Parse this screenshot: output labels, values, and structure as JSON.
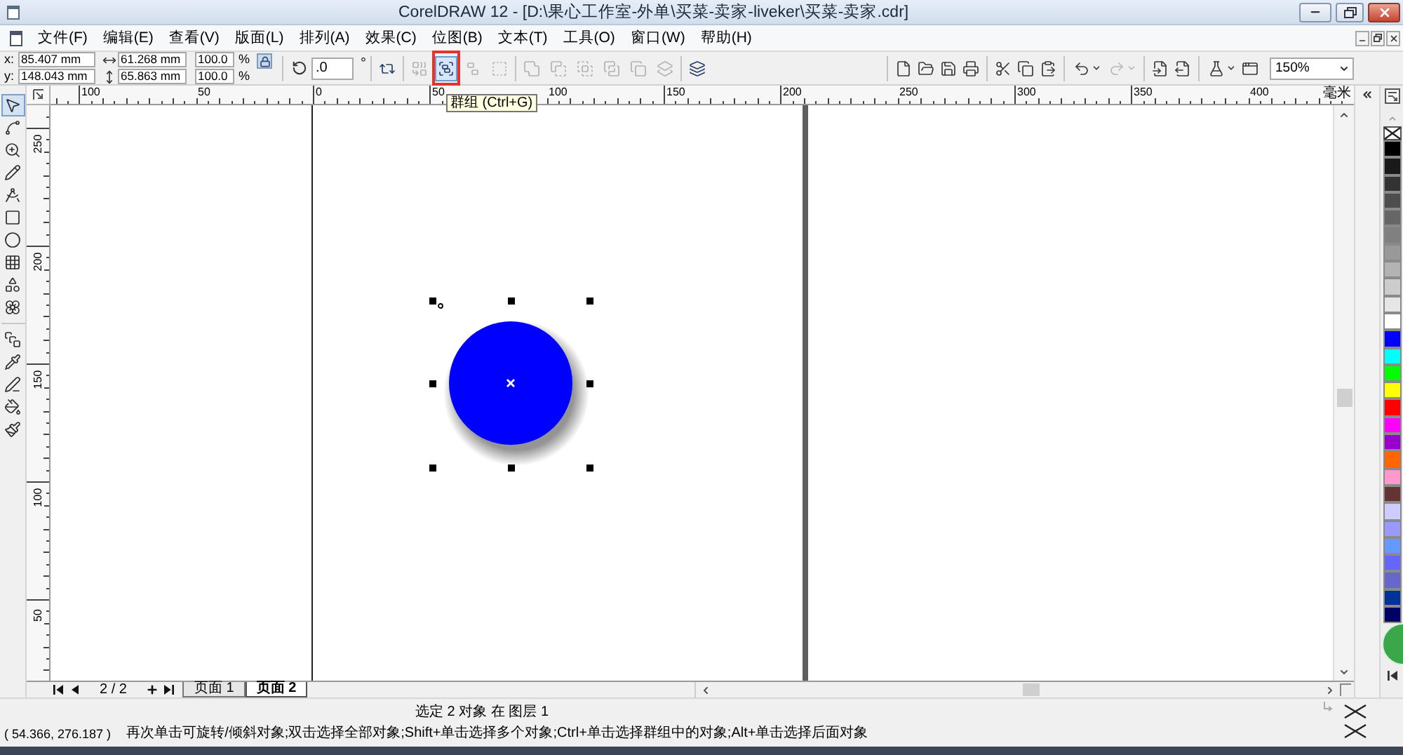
{
  "window": {
    "title": "CorelDRAW 12 - [D:\\果心工作室-外单\\买菜-卖家-liveker\\买菜-卖家.cdr]"
  },
  "menu": [
    "文件(F)",
    "编辑(E)",
    "查看(V)",
    "版面(L)",
    "排列(A)",
    "效果(C)",
    "位图(B)",
    "文本(T)",
    "工具(O)",
    "窗口(W)",
    "帮助(H)"
  ],
  "property_bar": {
    "position": [
      {
        "label": "x:",
        "value": "85.407 mm"
      },
      {
        "label": "y:",
        "value": "148.043 mm"
      }
    ],
    "size": [
      "61.268 mm",
      "65.863 mm"
    ],
    "scale": [
      {
        "value": "100.0",
        "unit": "%"
      },
      {
        "value": "100.0",
        "unit": "%"
      }
    ],
    "rotation": {
      "value": ".0",
      "unit": "°"
    },
    "button_groups": [
      [
        {
          "kind": "wrap",
          "disabled": false,
          "hovered": false
        }
      ],
      [
        {
          "kind": "combine",
          "disabled": true,
          "hovered": false
        },
        {
          "kind": "group",
          "disabled": false,
          "hovered": true
        },
        {
          "kind": "ungroup",
          "disabled": true,
          "hovered": false
        },
        {
          "kind": "ungroup_all",
          "disabled": true,
          "hovered": false
        }
      ],
      [
        {
          "kind": "weld",
          "disabled": true,
          "hovered": false
        },
        {
          "kind": "trim",
          "disabled": true,
          "hovered": false
        },
        {
          "kind": "intersect",
          "disabled": true,
          "hovered": false
        },
        {
          "kind": "simplify",
          "disabled": true,
          "hovered": false
        },
        {
          "kind": "front_minus_back",
          "disabled": true,
          "hovered": false
        },
        {
          "kind": "back_minus_front",
          "disabled": true,
          "hovered": false
        }
      ],
      [
        {
          "kind": "order",
          "disabled": false,
          "hovered": false
        }
      ]
    ]
  },
  "tooltip": {
    "text": "群组 (Ctrl+G)"
  },
  "standard_bar": {
    "button_groups": [
      [
        {
          "kind": "new",
          "disabled": false,
          "dropdown": false
        },
        {
          "kind": "open",
          "disabled": false,
          "dropdown": false
        },
        {
          "kind": "save",
          "disabled": false,
          "dropdown": false
        },
        {
          "kind": "print",
          "disabled": false,
          "dropdown": false
        }
      ],
      [
        {
          "kind": "cut",
          "disabled": false,
          "dropdown": false
        },
        {
          "kind": "copy",
          "disabled": false,
          "dropdown": false
        },
        {
          "kind": "paste",
          "disabled": false,
          "dropdown": false
        }
      ],
      [
        {
          "kind": "undo",
          "disabled": false,
          "dropdown": true
        },
        {
          "kind": "redo",
          "disabled": true,
          "dropdown": true
        }
      ],
      [
        {
          "kind": "import",
          "disabled": false,
          "dropdown": false
        },
        {
          "kind": "export",
          "disabled": false,
          "dropdown": false
        }
      ],
      [
        {
          "kind": "launcher",
          "disabled": false,
          "dropdown": true
        },
        {
          "kind": "welcome",
          "disabled": false,
          "dropdown": false
        }
      ]
    ],
    "zoom": "150%"
  },
  "horizontal_ruler": {
    "labels": [
      "100",
      "50",
      "0",
      "50",
      "100",
      "150",
      "200",
      "250",
      "300",
      "350",
      "400"
    ],
    "unit": "毫米"
  },
  "vertical_ruler": {
    "labels": [
      "250",
      "200",
      "150",
      "100",
      "50"
    ]
  },
  "toolbox": [
    [
      {
        "kind": "pick",
        "selected": true
      },
      {
        "kind": "shape",
        "selected": false
      },
      {
        "kind": "zoom",
        "selected": false
      },
      {
        "kind": "freehand",
        "selected": false
      },
      {
        "kind": "smart",
        "selected": false
      },
      {
        "kind": "rectangle",
        "selected": false
      },
      {
        "kind": "ellipse",
        "selected": false
      },
      {
        "kind": "graph",
        "selected": false
      },
      {
        "kind": "basic_shapes",
        "selected": false
      },
      {
        "kind": "perfect_shapes",
        "selected": false
      }
    ],
    [
      {
        "kind": "interactive",
        "selected": false
      },
      {
        "kind": "eyedropper",
        "selected": false
      },
      {
        "kind": "outline",
        "selected": false
      },
      {
        "kind": "fill",
        "selected": false
      },
      {
        "kind": "interactive_fill",
        "selected": false
      }
    ]
  ],
  "page_nav": {
    "counter": "2 / 2",
    "tabs": [
      {
        "label": "页面 1",
        "selected": false
      },
      {
        "label": "页面 2",
        "selected": true
      }
    ]
  },
  "palette": [
    {
      "color": "#000000"
    },
    {
      "color": "#1a1a1a"
    },
    {
      "color": "#333333"
    },
    {
      "color": "#4d4d4d"
    },
    {
      "color": "#666666"
    },
    {
      "color": "#808080"
    },
    {
      "color": "#999999"
    },
    {
      "color": "#b3b3b3"
    },
    {
      "color": "#cccccc"
    },
    {
      "color": "#e6e6e6"
    },
    {
      "color": "#ffffff"
    },
    {
      "color": "#0000ff"
    },
    {
      "color": "#00ffff"
    },
    {
      "color": "#00ff00"
    },
    {
      "color": "#ffff00"
    },
    {
      "color": "#ff0000"
    },
    {
      "color": "#ff00ff"
    },
    {
      "color": "#9900cc"
    },
    {
      "color": "#ff6600"
    },
    {
      "color": "#ff99cc"
    },
    {
      "color": "#663333"
    },
    {
      "color": "#ccccff"
    },
    {
      "color": "#9999ff"
    },
    {
      "color": "#6699ff"
    },
    {
      "color": "#6666ff"
    },
    {
      "color": "#6666cc"
    },
    {
      "color": "#003399"
    },
    {
      "color": "#000066"
    }
  ],
  "status_bar": {
    "selection": "选定 2 对象 在 图层 1",
    "coordinates": "( 54.366, 276.187 )",
    "hint": "再次单击可旋转/倾斜对象;双击选择全部对象;Shift+单击选择多个对象;Ctrl+单击选择群组中的对象;Alt+单击选择后面对象"
  }
}
